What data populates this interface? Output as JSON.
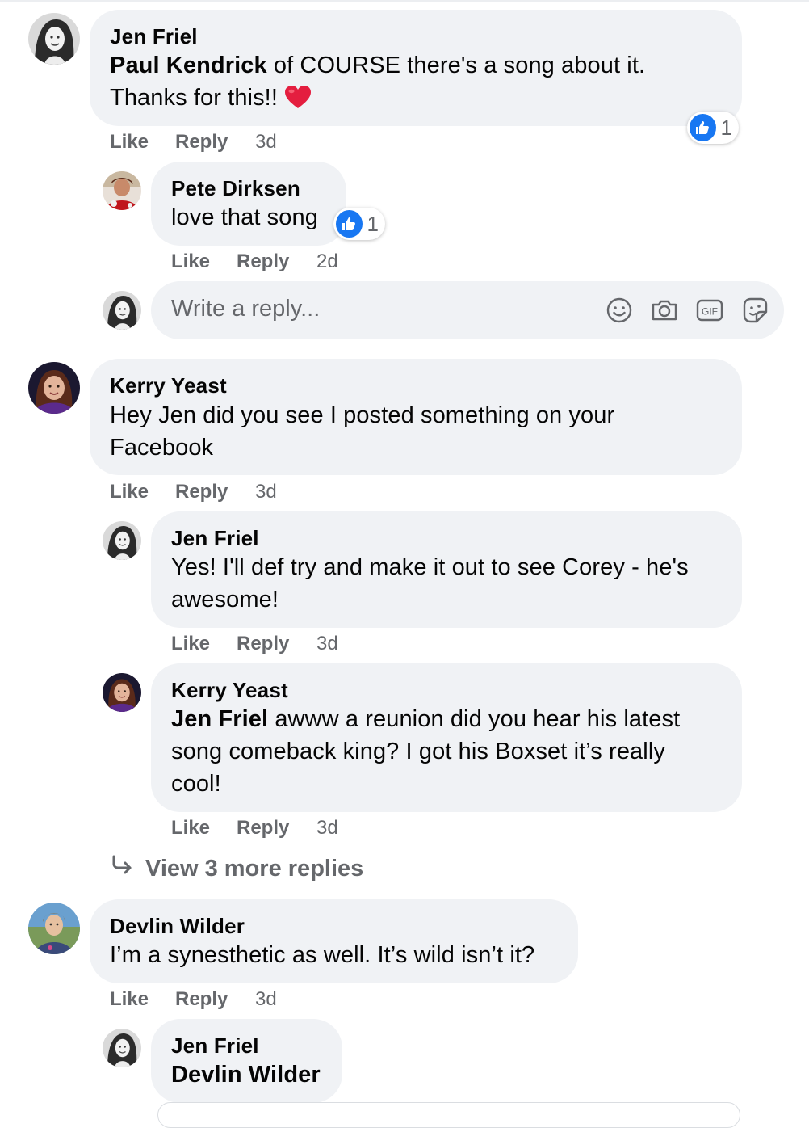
{
  "actions": {
    "like": "Like",
    "reply": "Reply"
  },
  "comments": [
    {
      "author": "Jen Friel",
      "mention": "Paul Kendrick",
      "line1": " of COURSE there's a song about it.",
      "line2": "Thanks for this!!",
      "line2_emoji": "red-heart",
      "time": "3d",
      "reaction_count": "1"
    },
    {
      "author": "Pete Dirksen",
      "line1": "love that song",
      "time": "2d",
      "reaction_count": "1"
    },
    {
      "author": "Kerry Yeast",
      "line1": "Hey Jen did you see I posted something on your",
      "line2": "Facebook",
      "time": "3d"
    },
    {
      "author": "Jen Friel",
      "line1": "Yes! I'll def try and make it out to see Corey - he's",
      "line2": "awesome!",
      "time": "3d"
    },
    {
      "author": "Kerry Yeast",
      "mention": "Jen Friel",
      "line1": " awww a reunion did you hear his latest",
      "line2": "song comeback king? I got his Boxset it’s really",
      "line3": "cool!",
      "time": "3d"
    },
    {
      "author": "Devlin Wilder",
      "line1": "I’m a synesthetic as well. It’s wild isn’t it?",
      "time": "3d"
    },
    {
      "author": "Jen Friel",
      "mention": "Devlin Wilder"
    }
  ],
  "reply_box": {
    "placeholder": "Write a reply...",
    "icons": [
      "smiley-icon",
      "camera-icon",
      "gif-icon",
      "sticker-icon"
    ]
  },
  "view_more": "View 3 more replies",
  "colors": {
    "bubble": "#f0f2f5",
    "secondary_text": "#65676b",
    "like_blue": "#1877f2",
    "heart_red": "#e41e3f"
  }
}
